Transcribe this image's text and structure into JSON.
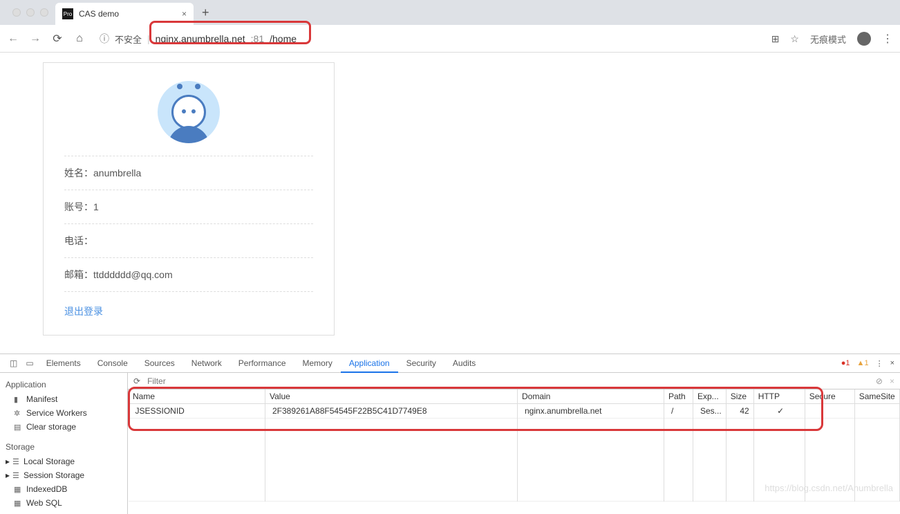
{
  "browser": {
    "tab_title": "CAS demo",
    "tab_favicon_text": "Pro",
    "insecure_label": "不安全",
    "url_host": "nginx.anumbrella.net",
    "url_port": ":81",
    "url_path": "/home",
    "incognito_label": "无痕模式"
  },
  "profile": {
    "name_label": "姓名：",
    "name_value": "anumbrella",
    "account_label": "账号：",
    "account_value": "1",
    "phone_label": "电话：",
    "phone_value": "",
    "email_label": "邮箱：",
    "email_value": "ttdddddd@qq.com",
    "logout_label": "退出登录"
  },
  "devtools": {
    "tabs": [
      "Elements",
      "Console",
      "Sources",
      "Network",
      "Performance",
      "Memory",
      "Application",
      "Security",
      "Audits"
    ],
    "active_tab": "Application",
    "error_count": "1",
    "warn_count": "1",
    "filter_placeholder": "Filter",
    "sidebar": {
      "app_header": "Application",
      "app_items": [
        "Manifest",
        "Service Workers",
        "Clear storage"
      ],
      "storage_header": "Storage",
      "storage_items": [
        "Local Storage",
        "Session Storage",
        "IndexedDB",
        "Web SQL"
      ]
    },
    "cookies": {
      "headers": [
        "Name",
        "Value",
        "Domain",
        "Path",
        "Exp...",
        "Size",
        "HTTP",
        "Secure",
        "SameSite"
      ],
      "rows": [
        {
          "name": "JSESSIONID",
          "value": "2F389261A88F54545F22B5C41D7749E8",
          "domain": "nginx.anumbrella.net",
          "path": "/",
          "expires": "Ses...",
          "size": "42",
          "http": "✓",
          "secure": "",
          "samesite": ""
        }
      ]
    }
  },
  "watermark": "https://blog.csdn.net/Anumbrella"
}
